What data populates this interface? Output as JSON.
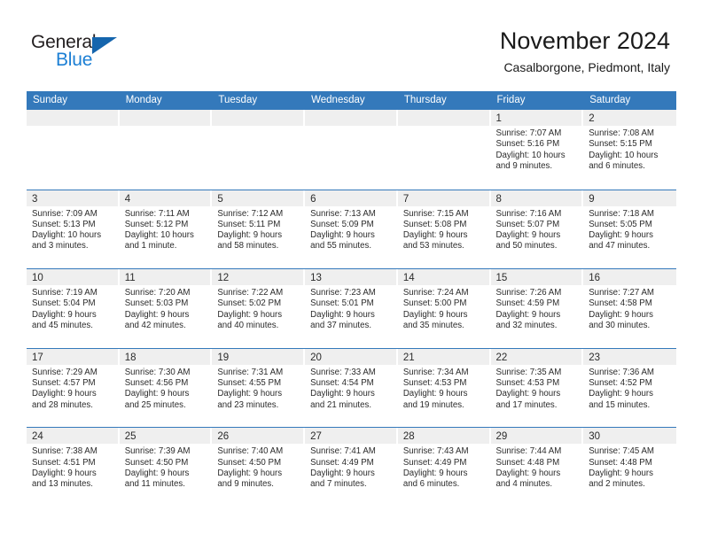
{
  "brand": {
    "name_part1": "General",
    "name_part2": "Blue",
    "triangle_icon": "triangle-icon",
    "colors": {
      "dark": "#231f20",
      "blue": "#1c7fd4",
      "triangle": "#1565ad"
    }
  },
  "header": {
    "title": "November 2024",
    "subtitle": "Casalborgone, Piedmont, Italy"
  },
  "theme": {
    "header_row_bg": "#3479bb",
    "day_band_bg": "#efefef",
    "cell_bg": "#ffffff",
    "text": "#2b2b2b"
  },
  "calendar": {
    "weekday_headers": [
      "Sunday",
      "Monday",
      "Tuesday",
      "Wednesday",
      "Thursday",
      "Friday",
      "Saturday"
    ],
    "weeks": [
      [
        {
          "day": "",
          "empty": true
        },
        {
          "day": "",
          "empty": true
        },
        {
          "day": "",
          "empty": true
        },
        {
          "day": "",
          "empty": true
        },
        {
          "day": "",
          "empty": true
        },
        {
          "day": "1",
          "empty": false,
          "sunrise": "Sunrise: 7:07 AM",
          "sunset": "Sunset: 5:16 PM",
          "daylight_line1": "Daylight: 10 hours",
          "daylight_line2": "and 9 minutes."
        },
        {
          "day": "2",
          "empty": false,
          "sunrise": "Sunrise: 7:08 AM",
          "sunset": "Sunset: 5:15 PM",
          "daylight_line1": "Daylight: 10 hours",
          "daylight_line2": "and 6 minutes."
        }
      ],
      [
        {
          "day": "3",
          "empty": false,
          "sunrise": "Sunrise: 7:09 AM",
          "sunset": "Sunset: 5:13 PM",
          "daylight_line1": "Daylight: 10 hours",
          "daylight_line2": "and 3 minutes."
        },
        {
          "day": "4",
          "empty": false,
          "sunrise": "Sunrise: 7:11 AM",
          "sunset": "Sunset: 5:12 PM",
          "daylight_line1": "Daylight: 10 hours",
          "daylight_line2": "and 1 minute."
        },
        {
          "day": "5",
          "empty": false,
          "sunrise": "Sunrise: 7:12 AM",
          "sunset": "Sunset: 5:11 PM",
          "daylight_line1": "Daylight: 9 hours",
          "daylight_line2": "and 58 minutes."
        },
        {
          "day": "6",
          "empty": false,
          "sunrise": "Sunrise: 7:13 AM",
          "sunset": "Sunset: 5:09 PM",
          "daylight_line1": "Daylight: 9 hours",
          "daylight_line2": "and 55 minutes."
        },
        {
          "day": "7",
          "empty": false,
          "sunrise": "Sunrise: 7:15 AM",
          "sunset": "Sunset: 5:08 PM",
          "daylight_line1": "Daylight: 9 hours",
          "daylight_line2": "and 53 minutes."
        },
        {
          "day": "8",
          "empty": false,
          "sunrise": "Sunrise: 7:16 AM",
          "sunset": "Sunset: 5:07 PM",
          "daylight_line1": "Daylight: 9 hours",
          "daylight_line2": "and 50 minutes."
        },
        {
          "day": "9",
          "empty": false,
          "sunrise": "Sunrise: 7:18 AM",
          "sunset": "Sunset: 5:05 PM",
          "daylight_line1": "Daylight: 9 hours",
          "daylight_line2": "and 47 minutes."
        }
      ],
      [
        {
          "day": "10",
          "empty": false,
          "sunrise": "Sunrise: 7:19 AM",
          "sunset": "Sunset: 5:04 PM",
          "daylight_line1": "Daylight: 9 hours",
          "daylight_line2": "and 45 minutes."
        },
        {
          "day": "11",
          "empty": false,
          "sunrise": "Sunrise: 7:20 AM",
          "sunset": "Sunset: 5:03 PM",
          "daylight_line1": "Daylight: 9 hours",
          "daylight_line2": "and 42 minutes."
        },
        {
          "day": "12",
          "empty": false,
          "sunrise": "Sunrise: 7:22 AM",
          "sunset": "Sunset: 5:02 PM",
          "daylight_line1": "Daylight: 9 hours",
          "daylight_line2": "and 40 minutes."
        },
        {
          "day": "13",
          "empty": false,
          "sunrise": "Sunrise: 7:23 AM",
          "sunset": "Sunset: 5:01 PM",
          "daylight_line1": "Daylight: 9 hours",
          "daylight_line2": "and 37 minutes."
        },
        {
          "day": "14",
          "empty": false,
          "sunrise": "Sunrise: 7:24 AM",
          "sunset": "Sunset: 5:00 PM",
          "daylight_line1": "Daylight: 9 hours",
          "daylight_line2": "and 35 minutes."
        },
        {
          "day": "15",
          "empty": false,
          "sunrise": "Sunrise: 7:26 AM",
          "sunset": "Sunset: 4:59 PM",
          "daylight_line1": "Daylight: 9 hours",
          "daylight_line2": "and 32 minutes."
        },
        {
          "day": "16",
          "empty": false,
          "sunrise": "Sunrise: 7:27 AM",
          "sunset": "Sunset: 4:58 PM",
          "daylight_line1": "Daylight: 9 hours",
          "daylight_line2": "and 30 minutes."
        }
      ],
      [
        {
          "day": "17",
          "empty": false,
          "sunrise": "Sunrise: 7:29 AM",
          "sunset": "Sunset: 4:57 PM",
          "daylight_line1": "Daylight: 9 hours",
          "daylight_line2": "and 28 minutes."
        },
        {
          "day": "18",
          "empty": false,
          "sunrise": "Sunrise: 7:30 AM",
          "sunset": "Sunset: 4:56 PM",
          "daylight_line1": "Daylight: 9 hours",
          "daylight_line2": "and 25 minutes."
        },
        {
          "day": "19",
          "empty": false,
          "sunrise": "Sunrise: 7:31 AM",
          "sunset": "Sunset: 4:55 PM",
          "daylight_line1": "Daylight: 9 hours",
          "daylight_line2": "and 23 minutes."
        },
        {
          "day": "20",
          "empty": false,
          "sunrise": "Sunrise: 7:33 AM",
          "sunset": "Sunset: 4:54 PM",
          "daylight_line1": "Daylight: 9 hours",
          "daylight_line2": "and 21 minutes."
        },
        {
          "day": "21",
          "empty": false,
          "sunrise": "Sunrise: 7:34 AM",
          "sunset": "Sunset: 4:53 PM",
          "daylight_line1": "Daylight: 9 hours",
          "daylight_line2": "and 19 minutes."
        },
        {
          "day": "22",
          "empty": false,
          "sunrise": "Sunrise: 7:35 AM",
          "sunset": "Sunset: 4:53 PM",
          "daylight_line1": "Daylight: 9 hours",
          "daylight_line2": "and 17 minutes."
        },
        {
          "day": "23",
          "empty": false,
          "sunrise": "Sunrise: 7:36 AM",
          "sunset": "Sunset: 4:52 PM",
          "daylight_line1": "Daylight: 9 hours",
          "daylight_line2": "and 15 minutes."
        }
      ],
      [
        {
          "day": "24",
          "empty": false,
          "sunrise": "Sunrise: 7:38 AM",
          "sunset": "Sunset: 4:51 PM",
          "daylight_line1": "Daylight: 9 hours",
          "daylight_line2": "and 13 minutes."
        },
        {
          "day": "25",
          "empty": false,
          "sunrise": "Sunrise: 7:39 AM",
          "sunset": "Sunset: 4:50 PM",
          "daylight_line1": "Daylight: 9 hours",
          "daylight_line2": "and 11 minutes."
        },
        {
          "day": "26",
          "empty": false,
          "sunrise": "Sunrise: 7:40 AM",
          "sunset": "Sunset: 4:50 PM",
          "daylight_line1": "Daylight: 9 hours",
          "daylight_line2": "and 9 minutes."
        },
        {
          "day": "27",
          "empty": false,
          "sunrise": "Sunrise: 7:41 AM",
          "sunset": "Sunset: 4:49 PM",
          "daylight_line1": "Daylight: 9 hours",
          "daylight_line2": "and 7 minutes."
        },
        {
          "day": "28",
          "empty": false,
          "sunrise": "Sunrise: 7:43 AM",
          "sunset": "Sunset: 4:49 PM",
          "daylight_line1": "Daylight: 9 hours",
          "daylight_line2": "and 6 minutes."
        },
        {
          "day": "29",
          "empty": false,
          "sunrise": "Sunrise: 7:44 AM",
          "sunset": "Sunset: 4:48 PM",
          "daylight_line1": "Daylight: 9 hours",
          "daylight_line2": "and 4 minutes."
        },
        {
          "day": "30",
          "empty": false,
          "sunrise": "Sunrise: 7:45 AM",
          "sunset": "Sunset: 4:48 PM",
          "daylight_line1": "Daylight: 9 hours",
          "daylight_line2": "and 2 minutes."
        }
      ]
    ]
  }
}
